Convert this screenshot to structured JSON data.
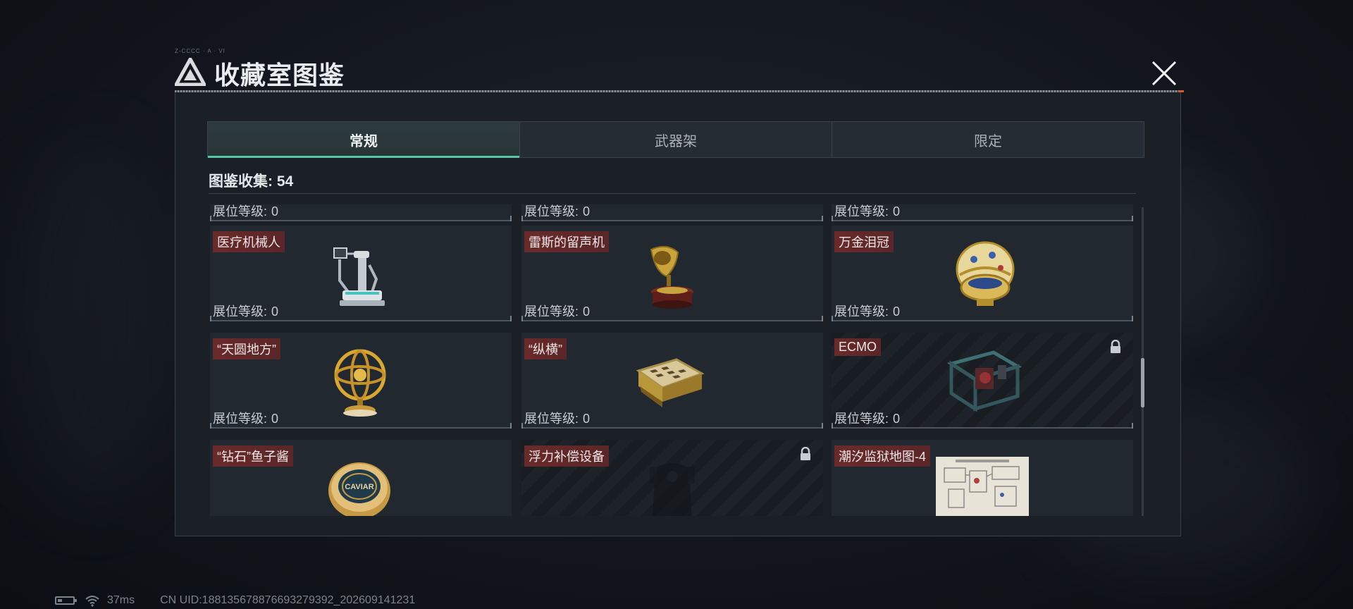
{
  "window": {
    "title": "收藏室图鉴",
    "tiny_caption": "Z-CCCC · A · VI"
  },
  "tabs": [
    {
      "label": "常规",
      "active": true
    },
    {
      "label": "武器架",
      "active": false
    },
    {
      "label": "限定",
      "active": false
    }
  ],
  "collection": {
    "label": "图鉴收集:",
    "count": "54"
  },
  "level_label": "展位等级:",
  "cards": [
    {
      "name": "",
      "level": "0",
      "locked": false
    },
    {
      "name": "",
      "level": "0",
      "locked": false
    },
    {
      "name": "",
      "level": "0",
      "locked": false
    },
    {
      "name": "医疗机械人",
      "level": "0",
      "locked": false,
      "icon": "medical-robot-icon"
    },
    {
      "name": "雷斯的留声机",
      "level": "0",
      "locked": false,
      "icon": "gramophone-icon"
    },
    {
      "name": "万金泪冠",
      "level": "0",
      "locked": false,
      "icon": "jeweled-egg-icon"
    },
    {
      "name": "“天圆地方”",
      "level": "0",
      "locked": false,
      "icon": "armillary-sphere-icon"
    },
    {
      "name": "“纵横”",
      "level": "0",
      "locked": false,
      "icon": "chess-box-icon"
    },
    {
      "name": "ECMO",
      "level": "0",
      "locked": true,
      "icon": "ecmo-machine-icon"
    },
    {
      "name": "“钻石”鱼子酱",
      "level": "",
      "locked": false,
      "icon": "caviar-tin-icon"
    },
    {
      "name": "浮力补偿设备",
      "level": "",
      "locked": true,
      "icon": "buoyancy-vest-icon"
    },
    {
      "name": "潮汐监狱地图-4",
      "level": "",
      "locked": false,
      "icon": "prison-map-icon"
    }
  ],
  "caviar_label": "CAVIAR",
  "status": {
    "ping": "37ms",
    "uid": "CN UID:188135678876693279392_202609141231"
  },
  "colors": {
    "accent": "#58c7a6",
    "name_tag": "#6a2a2a",
    "panel": "#1b2027"
  }
}
